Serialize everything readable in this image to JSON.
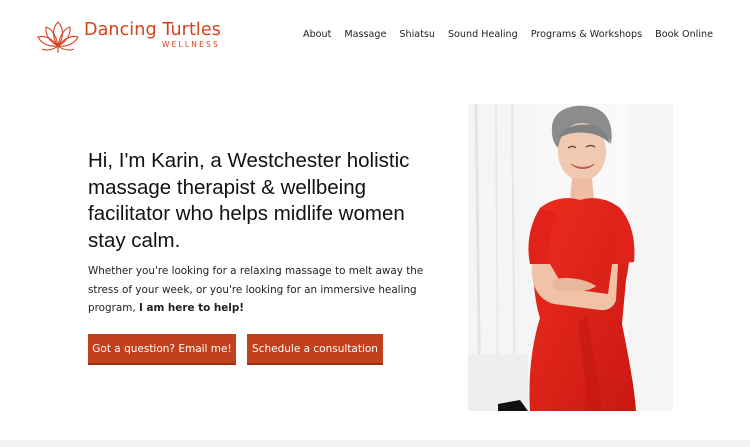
{
  "brand": {
    "name": "Dancing Turtles",
    "subtitle": "WELLNESS",
    "color": "#d8401c",
    "logo_icon": "lotus-icon"
  },
  "nav": {
    "items": [
      {
        "label": "About"
      },
      {
        "label": "Massage"
      },
      {
        "label": "Shiatsu"
      },
      {
        "label": "Sound Healing"
      },
      {
        "label": "Programs & Workshops"
      },
      {
        "label": "Book Online"
      }
    ]
  },
  "hero": {
    "title": "Hi, I'm Karin, a Westchester holistic massage therapist & wellbeing facilitator who helps midlife women stay calm.",
    "text_main": "Whether you're looking for a relaxing massage to melt away the stress of your week, or you're looking for an immersive healing program, ",
    "text_bold": "I am here to help!"
  },
  "buttons": {
    "email": "Got a question? Email me!",
    "consult": "Schedule a consultation",
    "color": "#c3401c"
  },
  "photo": {
    "description_icon": "portrait-photo",
    "dress_color": "#e8261c"
  }
}
